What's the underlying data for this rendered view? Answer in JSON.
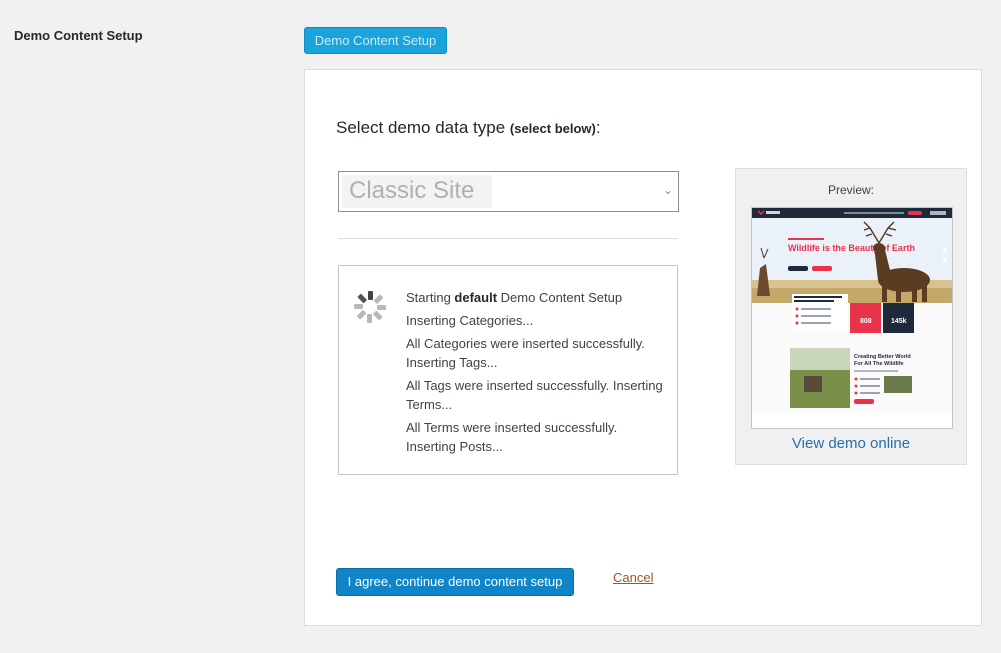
{
  "row_label": "Demo Content Setup",
  "top_button": "Demo Content Setup",
  "heading": {
    "main": "Select demo data type ",
    "sub": "(select below)",
    "colon": ":"
  },
  "select": {
    "value": "Classic Site",
    "arrow_icon": "chevron-down-icon"
  },
  "log": {
    "spinner_icon": "loading-spinner-icon",
    "lines": {
      "l0_pre": "Starting ",
      "l0_bold": "default",
      "l0_post": " Demo Content Setup",
      "l1": "Inserting Categories...",
      "l2": "All Categories were inserted successfully. Inserting Tags...",
      "l3": "All Tags were inserted successfully. Inserting Terms...",
      "l4": "All Terms were inserted successfully. Inserting Posts..."
    }
  },
  "preview": {
    "label": "Preview:",
    "thumb": {
      "hero_title": "Wildlife is the Beauty of Earth",
      "stat1": "808",
      "stat2": "145k",
      "section_title": "Creating Better World For All The Wildlife"
    },
    "link": "View demo online"
  },
  "actions": {
    "agree": "I agree, continue demo content setup",
    "cancel": "Cancel"
  },
  "colors": {
    "accent": "#0f85c8",
    "link": "#2271b1",
    "cancel": "#a0522d",
    "brand_red": "#e8334a",
    "dark_navy": "#1e2a3a"
  }
}
